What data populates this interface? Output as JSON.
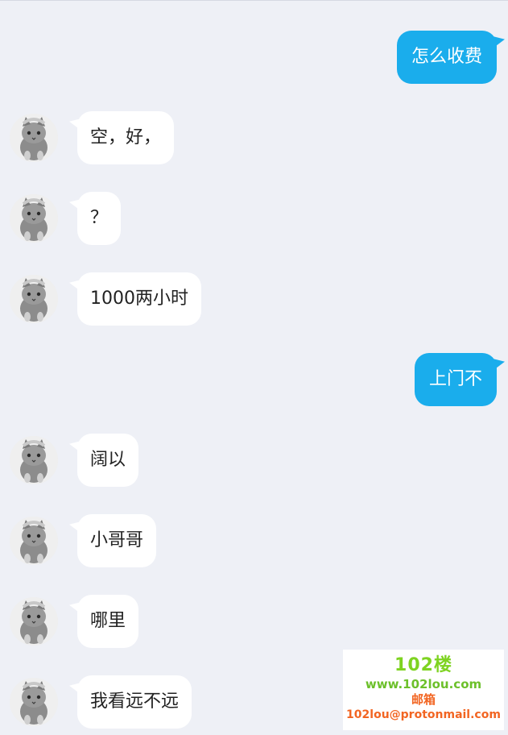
{
  "messages": [
    {
      "side": "out",
      "text": "怎么收费"
    },
    {
      "side": "in",
      "text": "空，好，"
    },
    {
      "side": "in",
      "text": "？"
    },
    {
      "side": "in",
      "text": "1000两小时"
    },
    {
      "side": "out",
      "text": "上门不"
    },
    {
      "side": "in",
      "text": "阔以"
    },
    {
      "side": "in",
      "text": "小哥哥"
    },
    {
      "side": "in",
      "text": "哪里"
    },
    {
      "side": "in",
      "text": "我看远不远"
    }
  ],
  "watermark": {
    "logo": "102楼",
    "site": "www.102lou.com",
    "mail_label": "邮箱",
    "mail": "102lou@protonmail.com"
  },
  "colors": {
    "background": "#eef0f6",
    "outgoing_bubble": "#1aadec",
    "incoming_bubble": "#ffffff",
    "watermark_green": "#7ed321",
    "watermark_orange": "#f26522"
  }
}
